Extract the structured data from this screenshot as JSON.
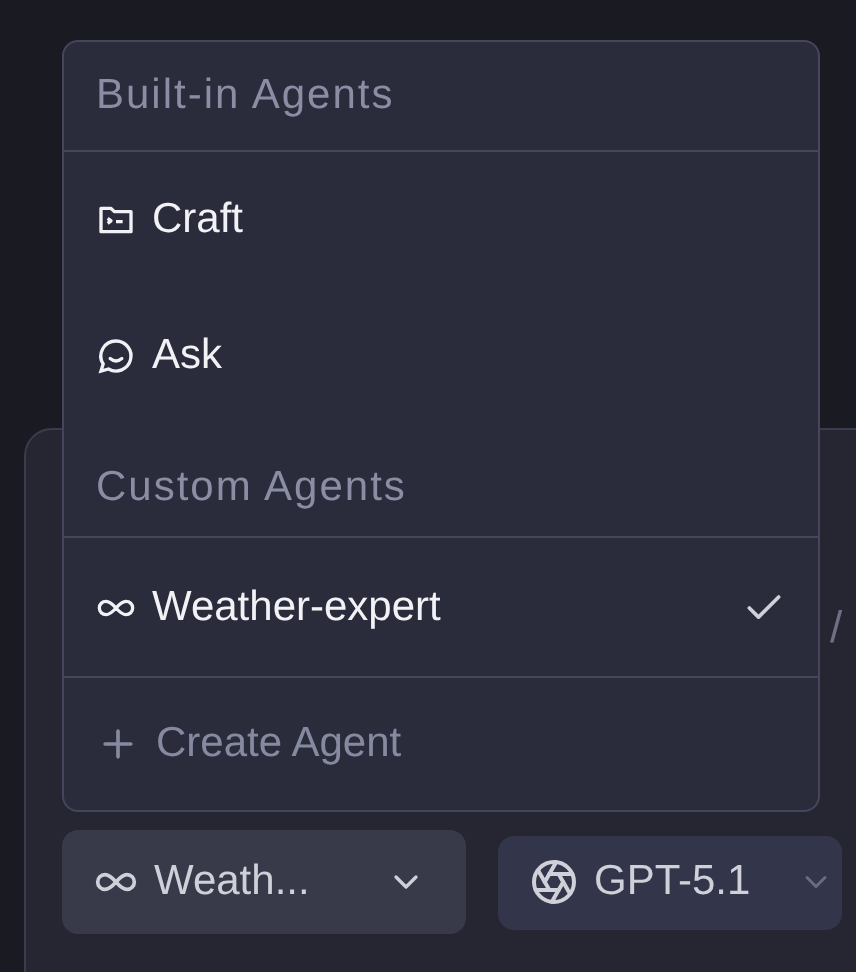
{
  "menu": {
    "sections": [
      {
        "title": "Built-in Agents",
        "items": [
          {
            "label": "Craft",
            "selected": false
          },
          {
            "label": "Ask",
            "selected": false
          }
        ]
      },
      {
        "title": "Custom Agents",
        "items": [
          {
            "label": "Weather-expert",
            "selected": true
          }
        ]
      }
    ],
    "create_action": {
      "label": "Create Agent"
    }
  },
  "prompt": {
    "text_fragment": "/"
  },
  "toolbar": {
    "agent_select": {
      "label": "Weath..."
    },
    "model_select": {
      "label": "GPT-5.1"
    }
  }
}
